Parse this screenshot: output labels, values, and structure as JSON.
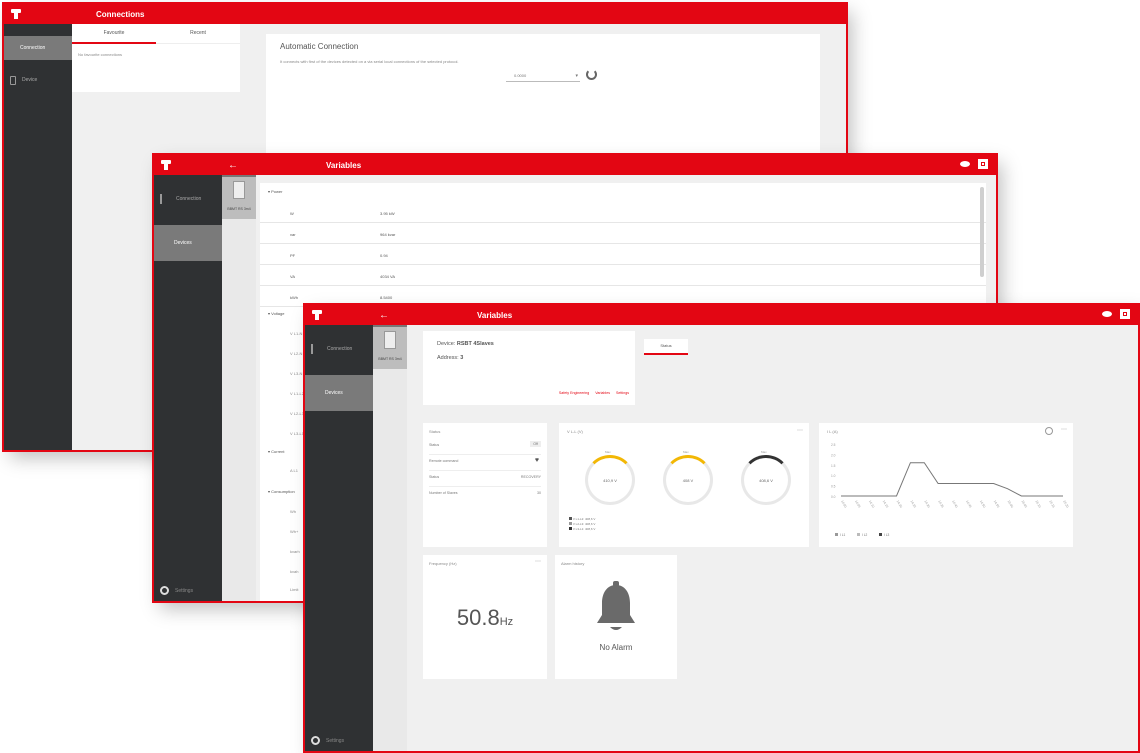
{
  "win1": {
    "title": "Connections",
    "sidebar": [
      {
        "label": "Connection"
      },
      {
        "label": "Device"
      }
    ],
    "tabs": [
      {
        "label": "Favourite"
      },
      {
        "label": "Recent"
      }
    ],
    "empty_text": "No favourite connections",
    "auto_title": "Automatic Connection",
    "auto_desc": "It connects with first of the devices detected on a via serial local connections of the selected protocol.",
    "select_value": "0.0000"
  },
  "win2": {
    "title": "Variables",
    "sidebar": [
      {
        "label": "Connection"
      },
      {
        "label": "Devices"
      }
    ],
    "device_tile": "BBMT RS 3m4",
    "group_power": "Power",
    "rows": [
      {
        "name": "W",
        "value": "3.95 kW"
      },
      {
        "name": "var",
        "value": "964 kvar"
      },
      {
        "name": "PF",
        "value": "0.94"
      },
      {
        "name": "VA",
        "value": "4034 VA"
      },
      {
        "name": "kWh",
        "value": "8.5400"
      }
    ],
    "group_voltage": "Voltage",
    "voltage_rows": [
      "V L1-N",
      "V L2-N",
      "V L3-N",
      "V L1-L2",
      "V L2-L3",
      "V L3-L1"
    ],
    "group_current": "Current",
    "current_row": "A L1",
    "group_consumption": "Consumption",
    "consumption_rows": [
      "Wh",
      "Wh+",
      "kvarh",
      "kvah",
      "Limit"
    ],
    "footer": "Settings"
  },
  "win3": {
    "title": "Variables",
    "sidebar": [
      {
        "label": "Connection"
      },
      {
        "label": "Devices"
      }
    ],
    "device_tile": "BBMT RS 3m4",
    "device_label": "Device:",
    "device_name": "RSBT 4Slaves",
    "address_label": "Address:",
    "address_value": "3",
    "links": [
      "Safety Engineering",
      "Variables",
      "Settings"
    ],
    "tab": "Status",
    "status_card": {
      "title": "Status",
      "rows": [
        {
          "k": "Status",
          "v": "Off"
        },
        {
          "k": "Remote command",
          "v": ""
        },
        {
          "k": "Status",
          "v": "RECOVERY"
        },
        {
          "k": "Number of Slaves",
          "v": "30"
        }
      ]
    },
    "voltage_card": {
      "title": "V L-L (V)",
      "gauges": [
        "410,9 V",
        "408 V",
        "408,6 V"
      ],
      "gauge_tops": [
        "Max",
        "Max",
        "Max"
      ],
      "legend": [
        "V L1-L2: 408,6 V",
        "V L2-L3: 408,6 V",
        "V L3-L1: 408,6 V"
      ]
    },
    "chart_card": {
      "title": "I L (A)"
    },
    "freq_card": {
      "title": "Frequency (Hz)",
      "value": "50.8",
      "unit": "Hz"
    },
    "alarm_card": {
      "title": "Alarm history",
      "text": "No Alarm"
    },
    "footer": "Settings"
  },
  "chart_data": {
    "type": "line",
    "title": "I L (A)",
    "yticks": [
      "2.5",
      "2.0",
      "1.5",
      "1.0",
      "0.5",
      "0.0"
    ],
    "ylim": [
      0,
      2.5
    ],
    "x": [
      "14:00",
      "14:05",
      "14:10",
      "14:15",
      "14:20",
      "14:25",
      "14:30",
      "14:35",
      "14:40",
      "14:45",
      "14:50",
      "14:55",
      "15:00",
      "15:05",
      "15:10",
      "15:15",
      "15:20"
    ],
    "series": [
      {
        "name": "I L1",
        "values": [
          0.05,
          0.05,
          0.05,
          0.05,
          0.05,
          1.65,
          1.65,
          0.65,
          0.65,
          0.65,
          0.65,
          0.65,
          0.4,
          0.05,
          0.05,
          0.05,
          0.05
        ]
      }
    ],
    "legend": [
      "I L1",
      "I L2",
      "I L3"
    ],
    "colors": {
      "accent": "#e30613",
      "line": "#777777"
    }
  }
}
